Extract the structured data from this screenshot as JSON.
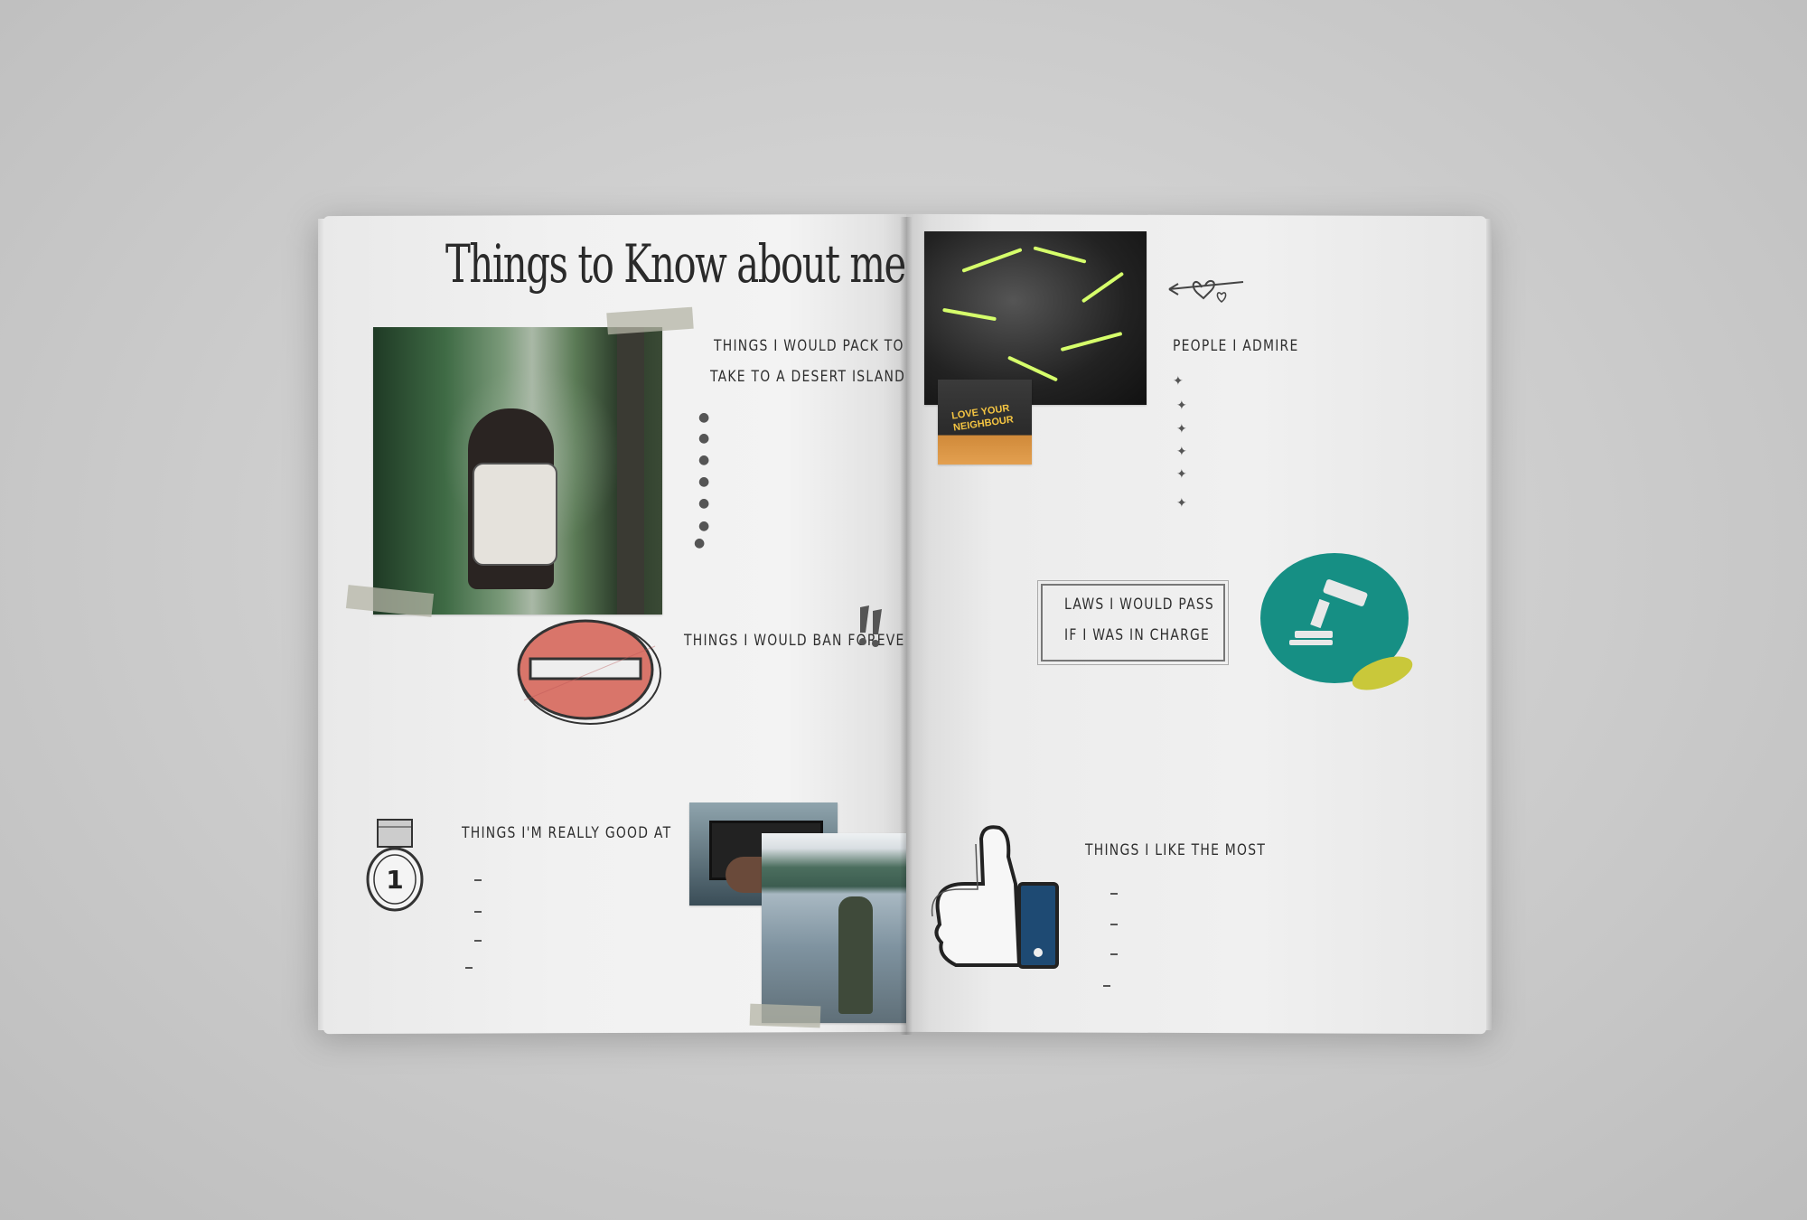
{
  "magazine": {
    "left_page": {
      "title": "Things to Know about me",
      "sections": [
        {
          "label_line1": "THINGS I WOULD PACK TO",
          "label_line2": "TAKE TO A DESERT ISLAND"
        },
        {
          "label": "THINGS I WOULD BAN FOREVER"
        },
        {
          "label": "THINGS I'M REALLY GOOD AT"
        }
      ],
      "medal_number": "1"
    },
    "right_page": {
      "sections": [
        {
          "label": "PEOPLE I ADMIRE"
        },
        {
          "label_line1": "LAWS I WOULD PASS",
          "label_line2": "IF I WAS IN CHARGE"
        },
        {
          "label": "THINGS I LIKE THE MOST"
        }
      ],
      "cap_text_line1": "LOVE YOUR",
      "cap_text_line2": "NEIGHBOUR"
    }
  },
  "colors": {
    "background": "#cfcfcf",
    "page": "#f0f0f0",
    "sticker_teal": "#168f84",
    "sticker_lime": "#c9c83a",
    "ban_red": "#d9756a",
    "thumb_blue": "#1e4a73"
  },
  "icons": [
    "ban-icon",
    "gavel-icon",
    "thumbs-up-icon",
    "medal-icon",
    "heart-arrow-icon"
  ]
}
